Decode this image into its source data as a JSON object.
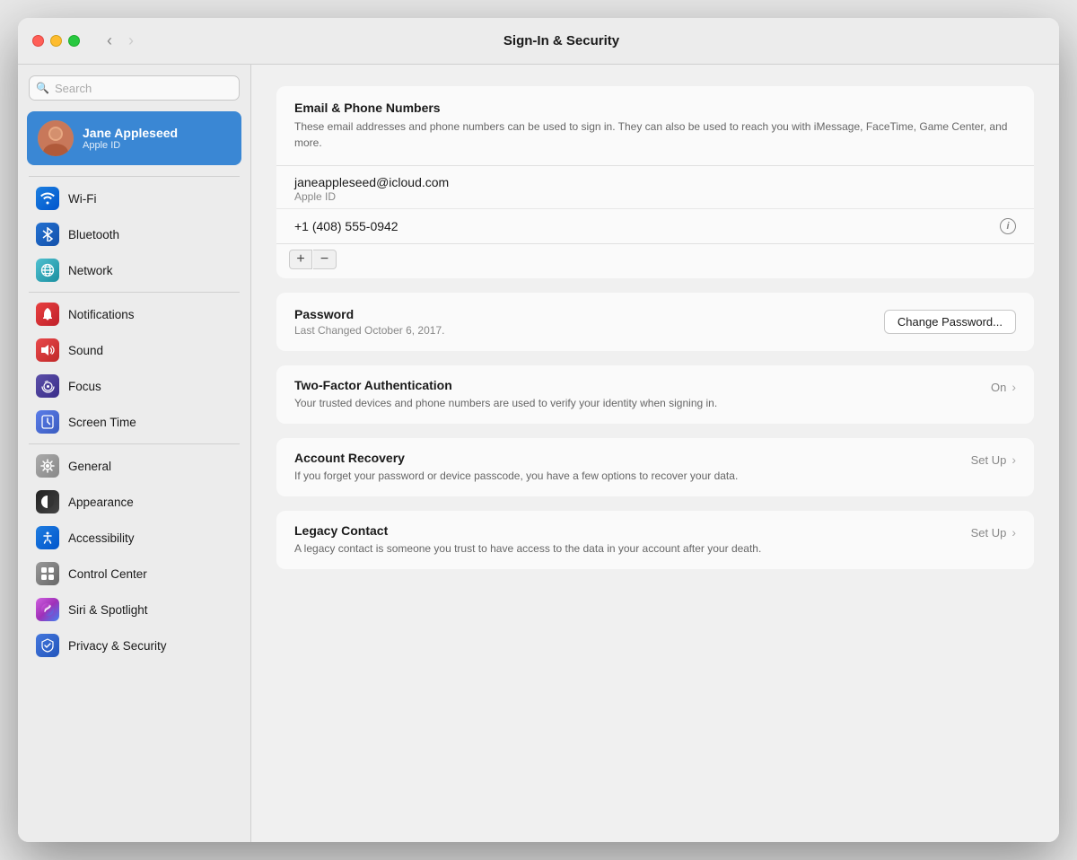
{
  "window": {
    "title": "Sign-In & Security"
  },
  "titlebar": {
    "back_label": "‹",
    "forward_label": "›",
    "title": "Sign-In & Security"
  },
  "sidebar": {
    "search_placeholder": "Search",
    "user": {
      "name": "Jane Appleseed",
      "subtitle": "Apple ID"
    },
    "items": [
      {
        "id": "wifi",
        "label": "Wi-Fi",
        "icon_type": "wifi"
      },
      {
        "id": "bluetooth",
        "label": "Bluetooth",
        "icon_type": "bluetooth"
      },
      {
        "id": "network",
        "label": "Network",
        "icon_type": "network"
      },
      {
        "id": "notifications",
        "label": "Notifications",
        "icon_type": "notifications"
      },
      {
        "id": "sound",
        "label": "Sound",
        "icon_type": "sound"
      },
      {
        "id": "focus",
        "label": "Focus",
        "icon_type": "focus"
      },
      {
        "id": "screentime",
        "label": "Screen Time",
        "icon_type": "screentime"
      },
      {
        "id": "general",
        "label": "General",
        "icon_type": "general"
      },
      {
        "id": "appearance",
        "label": "Appearance",
        "icon_type": "appearance"
      },
      {
        "id": "accessibility",
        "label": "Accessibility",
        "icon_type": "accessibility"
      },
      {
        "id": "controlcenter",
        "label": "Control Center",
        "icon_type": "controlcenter"
      },
      {
        "id": "siri",
        "label": "Siri & Spotlight",
        "icon_type": "siri"
      },
      {
        "id": "privacy",
        "label": "Privacy & Security",
        "icon_type": "privacy"
      }
    ]
  },
  "main": {
    "email_section": {
      "title": "Email & Phone Numbers",
      "description": "These email addresses and phone numbers can be used to sign in. They can also be used to reach you with iMessage, FaceTime, Game Center, and more.",
      "email": "janeappleseed@icloud.com",
      "email_label": "Apple ID",
      "phone": "+1 (408) 555-0942",
      "add_label": "+",
      "remove_label": "−"
    },
    "password_section": {
      "title": "Password",
      "last_changed": "Last Changed October 6, 2017.",
      "button_label": "Change Password..."
    },
    "two_factor": {
      "title": "Two-Factor Authentication",
      "description": "Your trusted devices and phone numbers are used to verify your identity when signing in.",
      "status": "On"
    },
    "account_recovery": {
      "title": "Account Recovery",
      "description": "If you forget your password or device passcode, you have a few options to recover your data.",
      "status": "Set Up"
    },
    "legacy_contact": {
      "title": "Legacy Contact",
      "description": "A legacy contact is someone you trust to have access to the data in your account after your death.",
      "status": "Set Up"
    }
  },
  "icons": {
    "wifi": "📶",
    "bluetooth": "𝔹",
    "network": "🌐",
    "notifications": "🔔",
    "sound": "🔊",
    "focus": "🌙",
    "screentime": "⏳",
    "general": "⚙",
    "appearance": "●",
    "accessibility": "♿",
    "controlcenter": "▦",
    "siri": "✦",
    "privacy": "✋"
  }
}
